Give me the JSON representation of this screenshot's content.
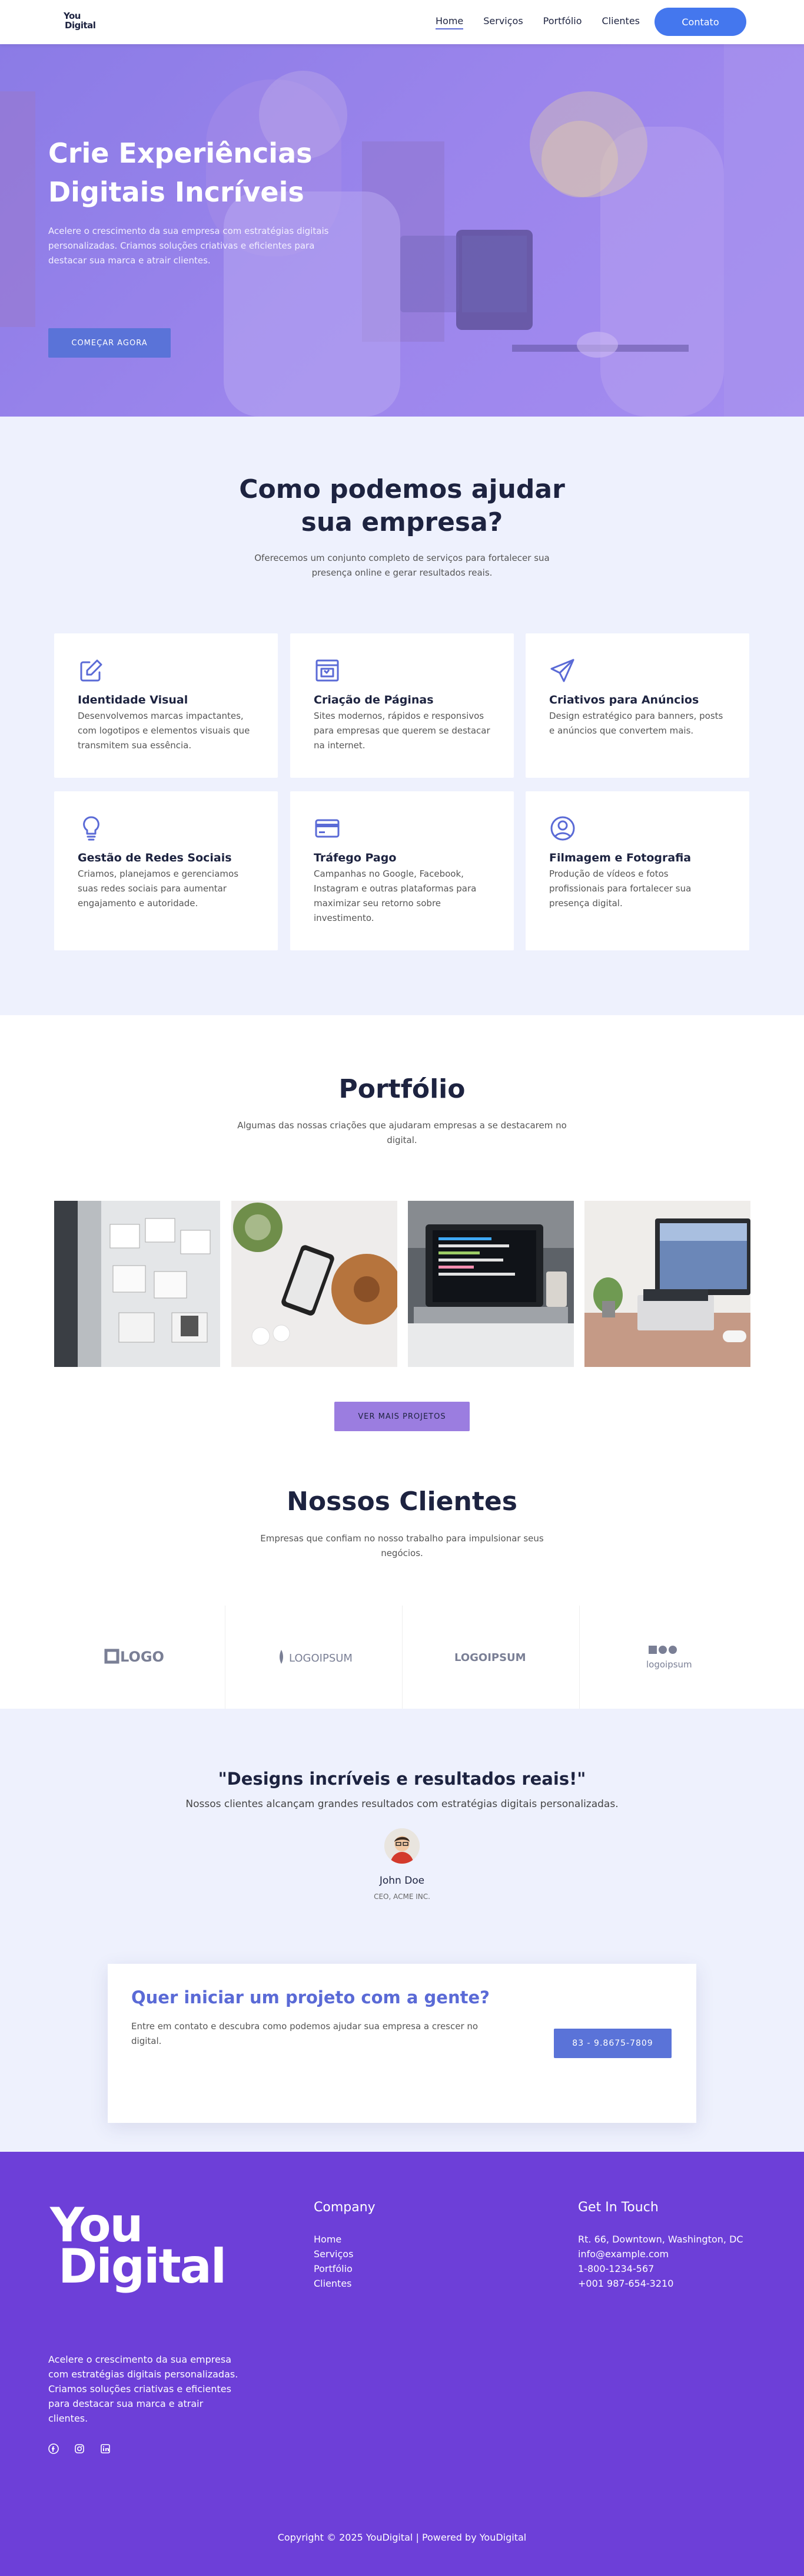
{
  "header": {
    "logo_top": "You",
    "logo_bottom": "Digital",
    "nav": [
      {
        "label": "Home",
        "active": true
      },
      {
        "label": "Serviços",
        "active": false
      },
      {
        "label": "Portfólio",
        "active": false
      },
      {
        "label": "Clientes",
        "active": false
      }
    ],
    "cta_label": "Contato"
  },
  "hero": {
    "title": "Crie Experiências Digitais Incríveis",
    "subtitle": "Acelere o crescimento da sua empresa com estratégias digitais personalizadas. Criamos soluções criativas e eficientes para destacar sua marca e atrair clientes.",
    "button_label": "COMEÇAR AGORA"
  },
  "services": {
    "title": "Como podemos ajudar sua empresa?",
    "subtitle": "Oferecemos um conjunto completo de serviços para fortalecer sua presença online e gerar resultados reais.",
    "items": [
      {
        "icon": "edit-icon",
        "title": "Identidade Visual",
        "text": "Desenvolvemos marcas impactantes, com logotipos e elementos visuais que transmitem sua essência."
      },
      {
        "icon": "web-page-icon",
        "title": "Criação de Páginas",
        "text": "Sites modernos, rápidos e responsivos para empresas que querem se destacar na internet."
      },
      {
        "icon": "paper-plane-icon",
        "title": "Criativos para Anúncios",
        "text": "Design estratégico para banners, posts e anúncios que convertem mais."
      },
      {
        "icon": "lightbulb-icon",
        "title": "Gestão de Redes Sociais",
        "text": "Criamos, planejamos e gerenciamos suas redes sociais para aumentar engajamento e autoridade."
      },
      {
        "icon": "credit-card-icon",
        "title": "Tráfego Pago",
        "text": "Campanhas no Google, Facebook, Instagram e outras plataformas para maximizar seu retorno sobre investimento."
      },
      {
        "icon": "user-circle-icon",
        "title": "Filmagem e Fotografia",
        "text": "Produção de vídeos e fotos profissionais para fortalecer sua presença digital."
      }
    ]
  },
  "portfolio": {
    "title": "Portfólio",
    "subtitle": "Algumas das nossas criações que ajudaram empresas a se destacarem no digital.",
    "button_label": "VER MAIS PROJETOS"
  },
  "clients": {
    "title": "Nossos Clientes",
    "subtitle": "Empresas que confiam no nosso trabalho para impulsionar seus negócios.",
    "logos": [
      "LOGO",
      "LOGOIPSUM",
      "LOGOIPSUM",
      "logoipsum"
    ]
  },
  "testimonial": {
    "quote": "\"Designs incríveis e resultados reais!\"",
    "text": "Nossos clientes alcançam grandes resultados com estratégias digitais personalizadas.",
    "name": "John Doe",
    "role": "CEO, ACME INC."
  },
  "cta": {
    "title": "Quer iniciar um projeto com a gente?",
    "text": "Entre em contato e descubra como podemos ajudar sua empresa a crescer no digital.",
    "button_label": "83 - 9.8675-7809"
  },
  "footer": {
    "logo_top": "You",
    "logo_bottom": "Digital",
    "description": "Acelere o crescimento da sua empresa com estratégias digitais personalizadas. Criamos soluções criativas e eficientes para destacar sua marca e atrair clientes.",
    "company_title": "Company",
    "company_links": [
      "Home",
      "Serviços",
      "Portfólio",
      "Clientes"
    ],
    "contact_title": "Get In Touch",
    "contact_lines": [
      "Rt. 66, Downtown, Washington, DC",
      "info@example.com",
      "1-800-1234-567",
      "+001 987-654-3210"
    ],
    "copyright": "Copyright © 2025 YouDigital | Powered by YouDigital"
  },
  "colors": {
    "primary": "#4477ee",
    "accent": "#5a6ad6",
    "footer": "#6d3fd8",
    "hero": "#9b85ec"
  }
}
